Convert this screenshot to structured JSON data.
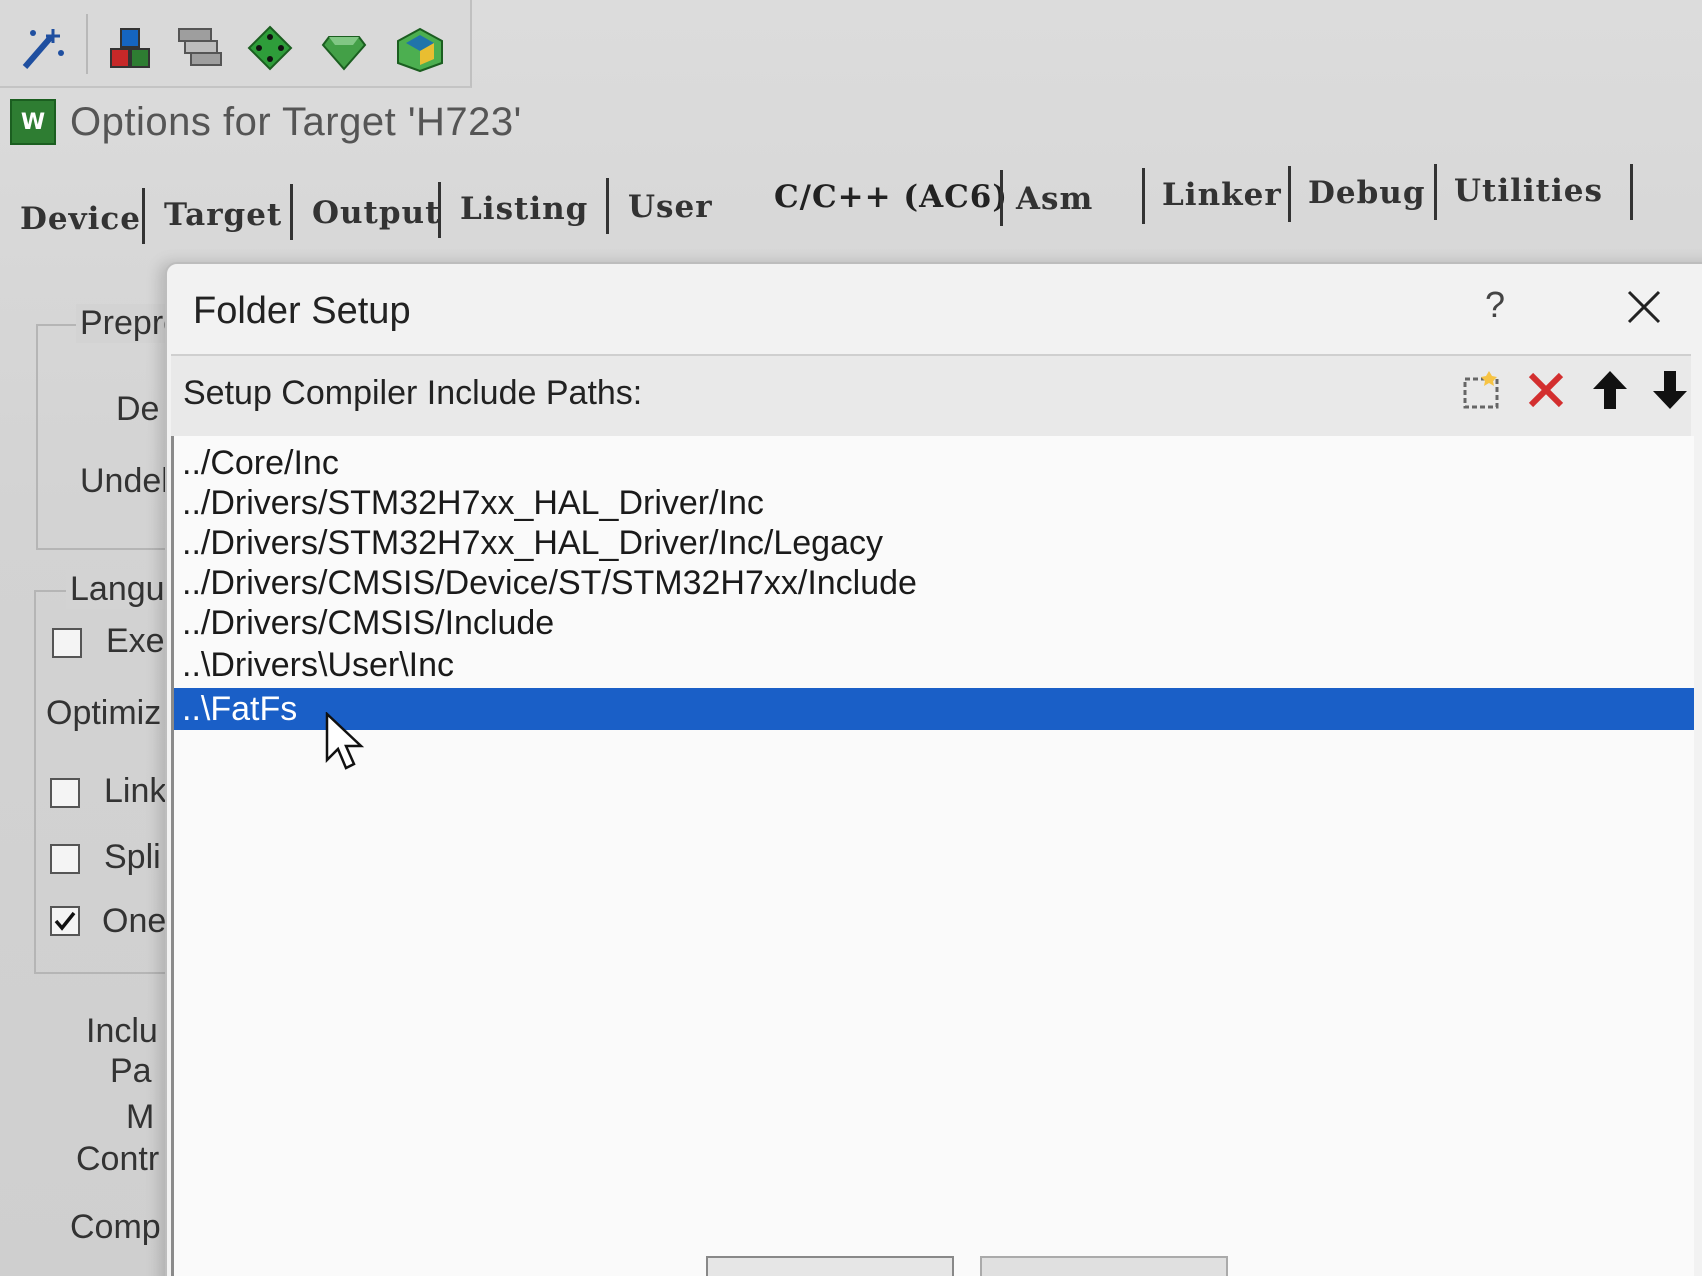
{
  "toolbar": {
    "icons": [
      "magic-wand-icon",
      "components-icon",
      "layers-icon",
      "green-diamond-icon",
      "gem-icon",
      "pack-installer-icon"
    ]
  },
  "window": {
    "title": "Options for Target 'H723'",
    "icon_text": "W"
  },
  "tabs": [
    {
      "label": "Device"
    },
    {
      "label": "Target"
    },
    {
      "label": "Output"
    },
    {
      "label": "Listing"
    },
    {
      "label": "User"
    },
    {
      "label": "C/C++ (AC6)"
    },
    {
      "label": "Asm"
    },
    {
      "label": "Linker"
    },
    {
      "label": "Debug"
    },
    {
      "label": "Utilities"
    }
  ],
  "background_page": {
    "labels": [
      "Prepro",
      "De",
      "Undel",
      "Langu",
      "Exe",
      "Optimiz",
      "Link",
      "Spli",
      "One",
      "Inclu",
      "Pa",
      "M",
      "Contr",
      "Comp"
    ],
    "checkboxes": [
      {
        "label": "Exe",
        "checked": false
      },
      {
        "label": "Link",
        "checked": false
      },
      {
        "label": "Spli",
        "checked": false
      },
      {
        "label": "One",
        "checked": true
      }
    ]
  },
  "dialog": {
    "title": "Folder Setup",
    "help": "?",
    "header_label": "Setup Compiler Include Paths:",
    "buttons": [
      "new-folder-icon",
      "delete-icon",
      "move-up-icon",
      "move-down-icon"
    ],
    "paths": [
      "../Core/Inc",
      "../Drivers/STM32H7xx_HAL_Driver/Inc",
      "../Drivers/STM32H7xx_HAL_Driver/Inc/Legacy",
      "../Drivers/CMSIS/Device/ST/STM32H7xx/Include",
      "../Drivers/CMSIS/Include",
      "..\\Drivers\\User\\Inc",
      "..\\FatFs"
    ],
    "selected_index": 6
  },
  "colors": {
    "selection": "#1a5fc7",
    "list_bg": "#fafafa"
  }
}
